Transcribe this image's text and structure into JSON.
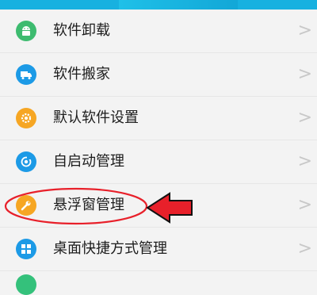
{
  "menu": {
    "items": [
      {
        "label": "软件卸载",
        "icon": "android-icon",
        "color": "#3dbb6f"
      },
      {
        "label": "软件搬家",
        "icon": "truck-icon",
        "color": "#1c9ae6"
      },
      {
        "label": "默认软件设置",
        "icon": "gear-icon",
        "color": "#f6a623"
      },
      {
        "label": "自启动管理",
        "icon": "power-cycle-icon",
        "color": "#1c9ae6"
      },
      {
        "label": "悬浮窗管理",
        "icon": "wrench-icon",
        "color": "#f6a623"
      },
      {
        "label": "桌面快捷方式管理",
        "icon": "grid-icon",
        "color": "#1c9ae6"
      }
    ],
    "chevron": ">"
  },
  "colors": {
    "header": "#17b1e0",
    "annotation_red": "#e8202a"
  }
}
